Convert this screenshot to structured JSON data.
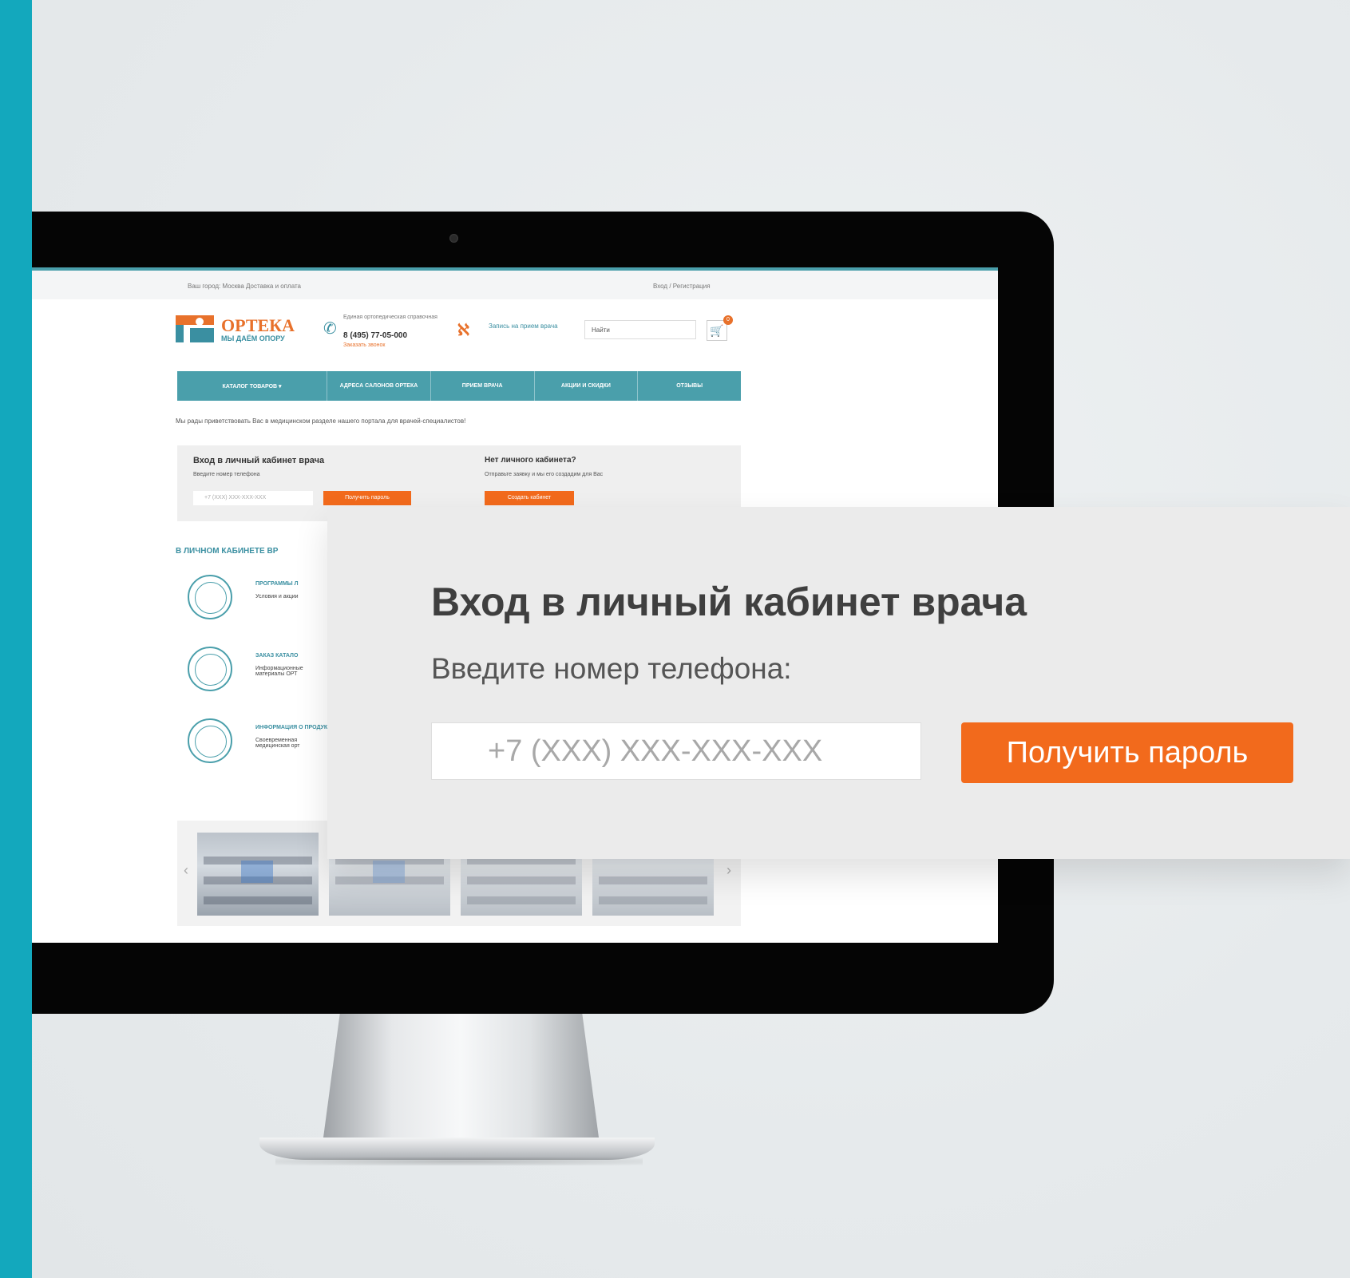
{
  "site": {
    "topbar": {
      "city": "Ваш город: Москва   Доставка и оплата",
      "login": "Вход / Регистрация"
    },
    "logo": {
      "name": "ОРТЕКА",
      "tagline": "МЫ ДАЁМ ОПОРУ"
    },
    "phone": {
      "caption": "Единая ортопедическая справочная",
      "number": "8 (495) 77-05-000",
      "callback": "Заказать звонок"
    },
    "doctor_link": "Запись на прием врача",
    "search_placeholder": "Найти",
    "cart_count": "0",
    "nav": [
      "КАТАЛОГ ТОВАРОВ ▾",
      "АДРЕСА САЛОНОВ ОРТЕКА",
      "ПРИЕМ ВРАЧА",
      "АКЦИИ И СКИДКИ",
      "ОТЗЫВЫ"
    ],
    "welcome": "Мы рады приветствовать Вас в медицинском разделе нашего портала для врачей-специалистов!",
    "login_panel": {
      "title": "Вход в личный кабинет врача",
      "subtitle": "Введите номер телефона",
      "input_placeholder": "+7 (XXX) XXX-XXX-XXX",
      "button": "Получить пароль",
      "no_account_title": "Нет личного кабинета?",
      "no_account_sub": "Отправьте заявку и мы его создадим для Вас",
      "no_account_button": "Создать кабинет"
    },
    "cabinet_heading": "В ЛИЧНОМ КАБИНЕТЕ ВР",
    "features": [
      {
        "title": "ПРОГРАММЫ Л",
        "text": "Условия и акции"
      },
      {
        "title": "ЗАКАЗ КАТАЛО",
        "text": "Информационные материалы ОРТ"
      },
      {
        "title": "ИНФОРМАЦИЯ О ПРОДУКЦИИ",
        "text": "Своевременная медицинская орт"
      }
    ]
  },
  "overlay": {
    "title": "Вход в личный кабинет врача",
    "subtitle": "Введите номер телефона:",
    "input_placeholder": "+7 (XXX) XXX-XXX-XXX",
    "button": "Получить пароль"
  },
  "colors": {
    "accent": "#13a8bd",
    "orange": "#f26a1c",
    "teal": "#4a9fab"
  }
}
